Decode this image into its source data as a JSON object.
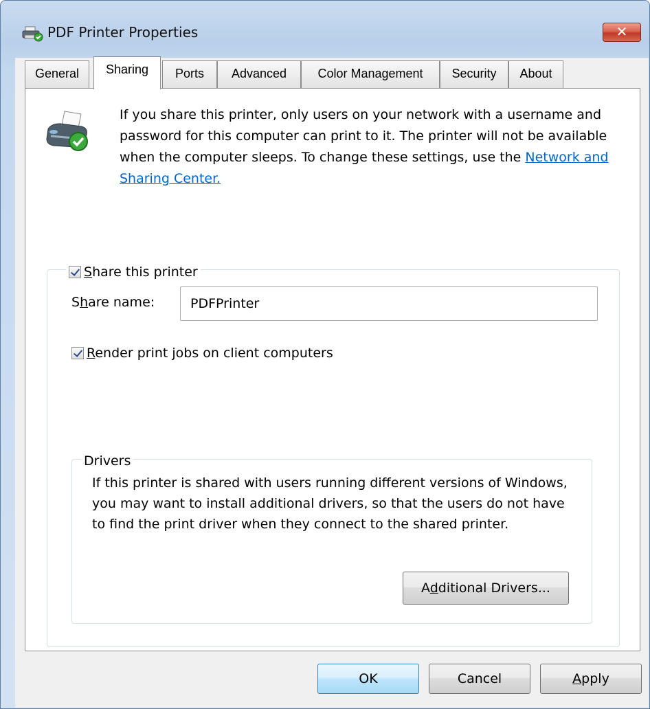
{
  "window": {
    "title": "PDF Printer Properties",
    "close_glyph": "✕"
  },
  "tabs": [
    {
      "label": "General",
      "active": false
    },
    {
      "label": "Sharing",
      "active": true
    },
    {
      "label": "Ports",
      "active": false
    },
    {
      "label": "Advanced",
      "active": false
    },
    {
      "label": "Color Management",
      "active": false
    },
    {
      "label": "Security",
      "active": false
    },
    {
      "label": "About",
      "active": false
    }
  ],
  "sharing": {
    "intro_text": "If you share this printer, only users on your network with a username and password for this computer can print to it. The printer will not be available when the computer sleeps. To change these settings, use the ",
    "link_text": "Network and Sharing Center.",
    "share_checkbox": {
      "checked": true,
      "mnemonic": "S",
      "rest": "hare this printer"
    },
    "share_name_label": {
      "pre": "S",
      "mnemonic": "h",
      "rest": "are name:"
    },
    "share_name_value": "PDFPrinter",
    "render_checkbox": {
      "checked": true,
      "mnemonic": "R",
      "rest": "ender print jobs on client computers"
    },
    "drivers": {
      "legend": "Drivers",
      "text": "If this printer is shared with users running different versions of Windows, you may want to install additional drivers, so that the users do not have to find the print driver when they connect to the shared printer.",
      "button": {
        "pre": "A",
        "mnemonic": "d",
        "rest": "ditional Drivers..."
      }
    }
  },
  "footer": {
    "ok_label": "OK",
    "cancel_label": "Cancel",
    "apply": {
      "mnemonic": "A",
      "rest": "pply"
    }
  },
  "icons": {
    "title_icon": "printer-shared-icon",
    "printer_icon": "printer-shared-icon",
    "close_icon": "close-icon"
  },
  "colors": {
    "link": "#0066cc",
    "close_button": "#c0392b",
    "default_button_border": "#3c7fb1"
  }
}
